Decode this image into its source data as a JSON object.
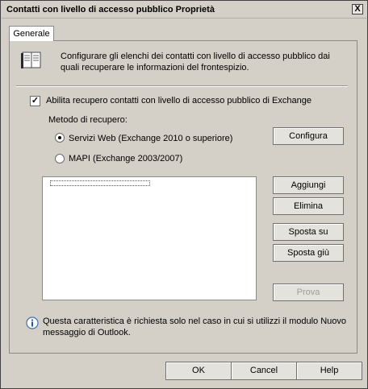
{
  "window": {
    "title": "Contatti con livello di accesso pubblico Proprietà",
    "close_label": "X"
  },
  "tabs": [
    {
      "label": "Generale",
      "selected": true
    }
  ],
  "general": {
    "description": "Configurare gli elenchi dei contatti con livello di accesso pubblico dai quali recuperare le informazioni del frontespizio.",
    "enable_checkbox": {
      "label": "Abilita recupero contatti con livello di accesso pubblico di Exchange",
      "checked": true
    },
    "method_label": "Metodo di recupero:",
    "methods": [
      {
        "label": "Servizi Web (Exchange 2010 o superiore)",
        "selected": true
      },
      {
        "label": "MAPI (Exchange 2003/2007)",
        "selected": false
      }
    ],
    "configure_button": "Configura",
    "list_items": [],
    "buttons": {
      "add": "Aggiungi",
      "delete": "Elimina",
      "move_up": "Sposta su",
      "move_down": "Sposta giù",
      "test": "Prova"
    },
    "info_text": "Questa caratteristica è richiesta solo nel caso in cui si utilizzi il modulo Nuovo messaggio di Outlook."
  },
  "footer": {
    "ok": "OK",
    "cancel": "Cancel",
    "help": "Help"
  },
  "icons": {
    "book": "address-book-icon",
    "info": "info-icon"
  }
}
